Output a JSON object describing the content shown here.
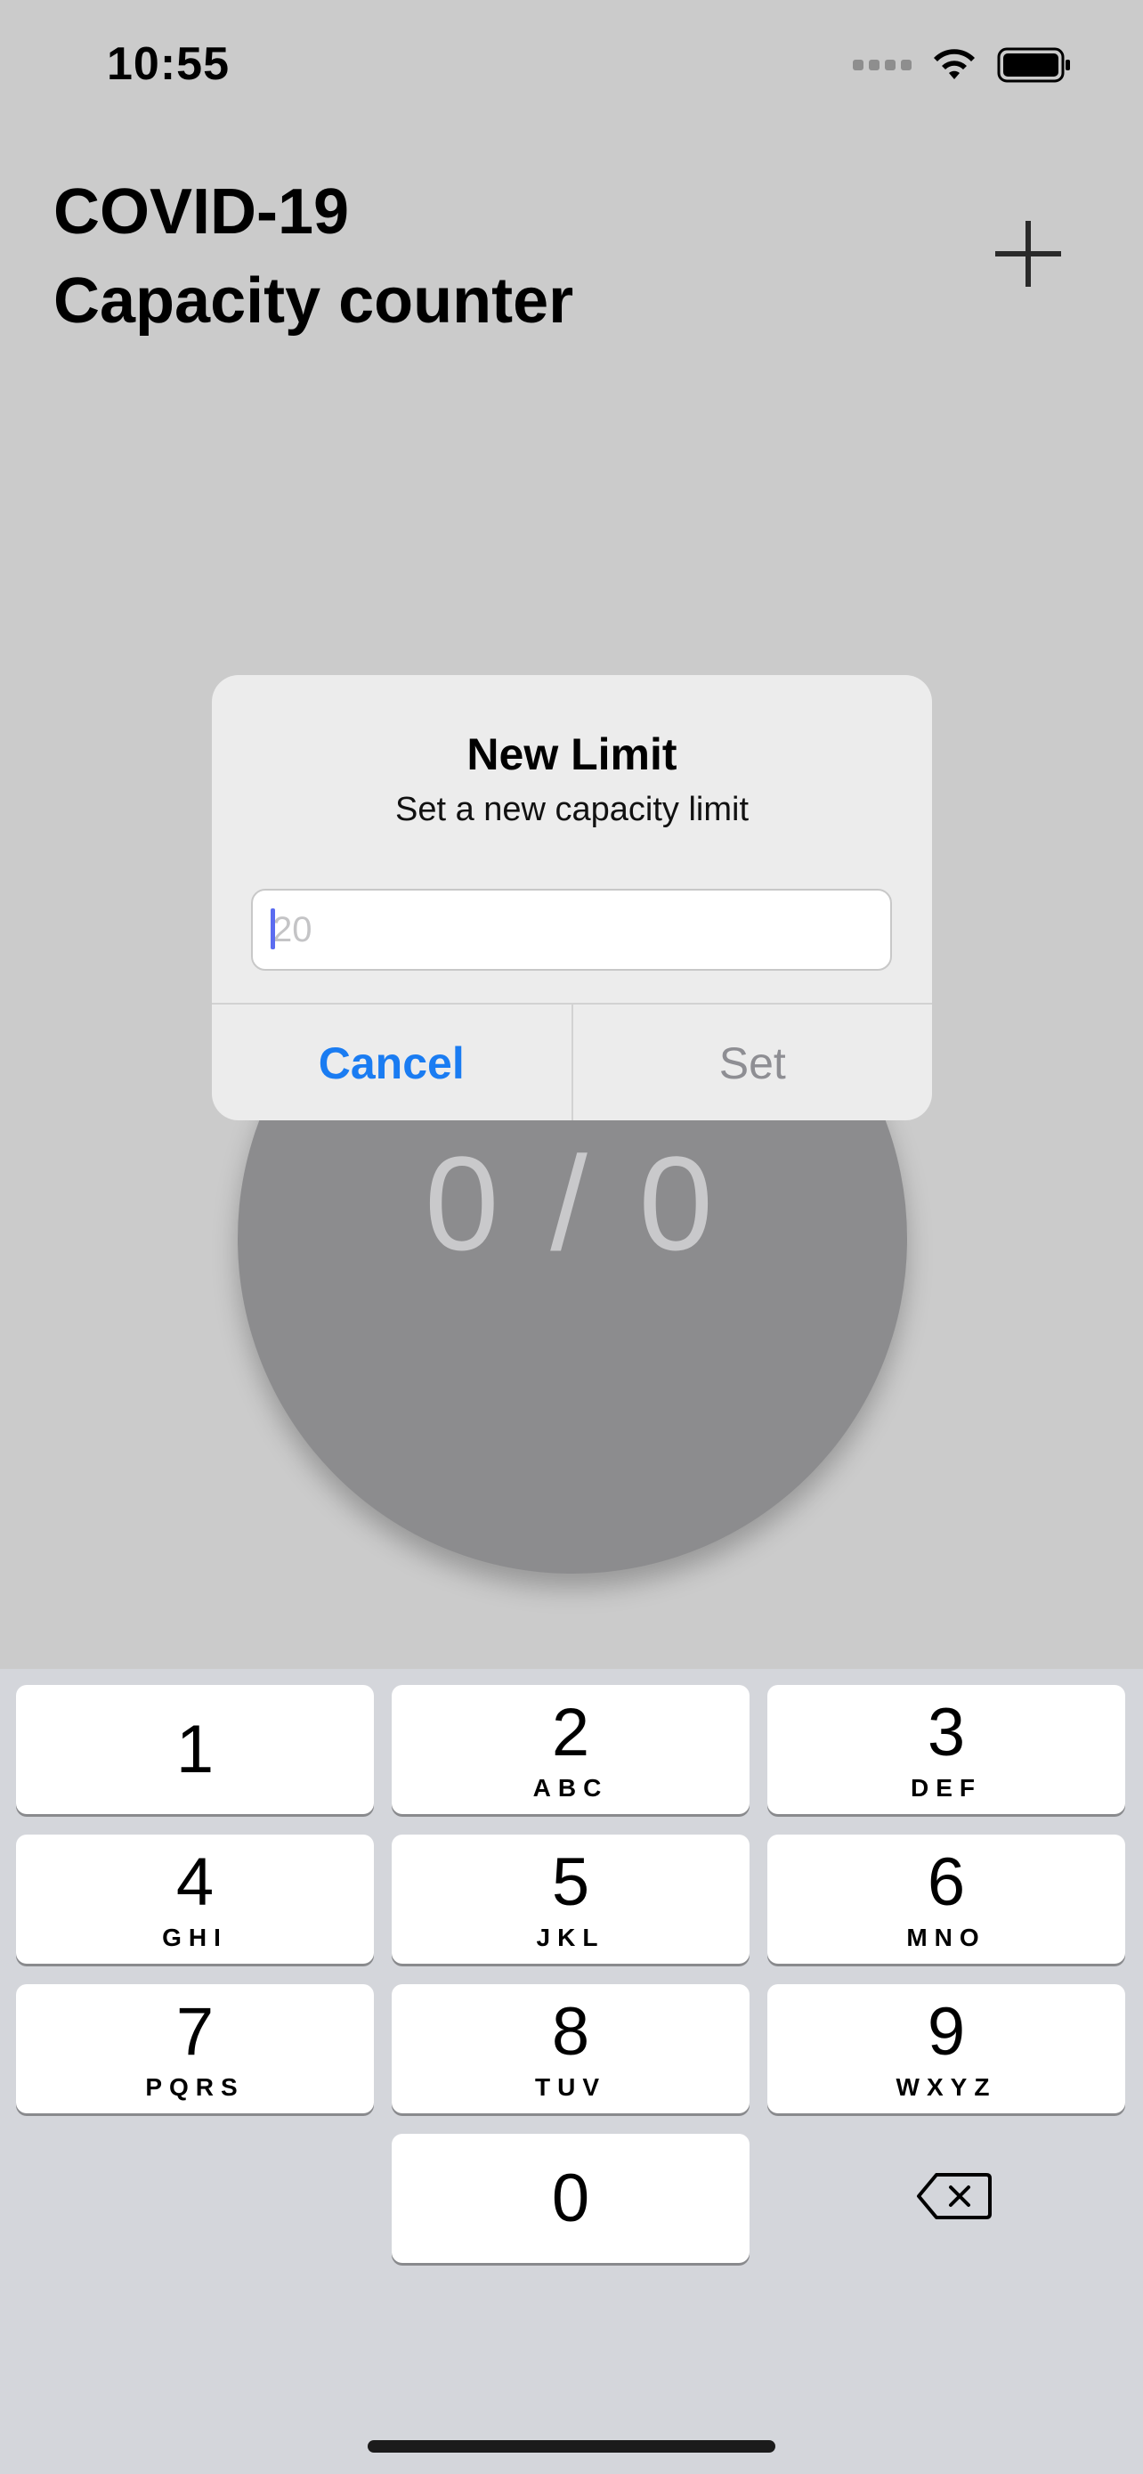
{
  "status_bar": {
    "time": "10:55",
    "icons": [
      "signal-icon",
      "wifi-icon",
      "battery-icon"
    ]
  },
  "header": {
    "title_line1": "COVID-19",
    "title_line2": "Capacity counter",
    "add_icon": "plus-icon"
  },
  "counter": {
    "text": "0 / 0"
  },
  "alert": {
    "title": "New Limit",
    "message": "Set a new capacity limit",
    "input_value": "",
    "input_placeholder": "20",
    "cancel_label": "Cancel",
    "set_label": "Set"
  },
  "keyboard": {
    "keys": [
      {
        "digit": "1",
        "letters": ""
      },
      {
        "digit": "2",
        "letters": "ABC"
      },
      {
        "digit": "3",
        "letters": "DEF"
      },
      {
        "digit": "4",
        "letters": "GHI"
      },
      {
        "digit": "5",
        "letters": "JKL"
      },
      {
        "digit": "6",
        "letters": "MNO"
      },
      {
        "digit": "7",
        "letters": "PQRS"
      },
      {
        "digit": "8",
        "letters": "TUV"
      },
      {
        "digit": "9",
        "letters": "WXYZ"
      },
      {
        "digit": "0",
        "letters": ""
      }
    ],
    "delete_icon": "backspace-icon"
  },
  "colors": {
    "accent": "#1a7cf2",
    "background": "#cbcbcb",
    "circle": "#8c8c8e",
    "keyboard": "#d4d6db"
  }
}
